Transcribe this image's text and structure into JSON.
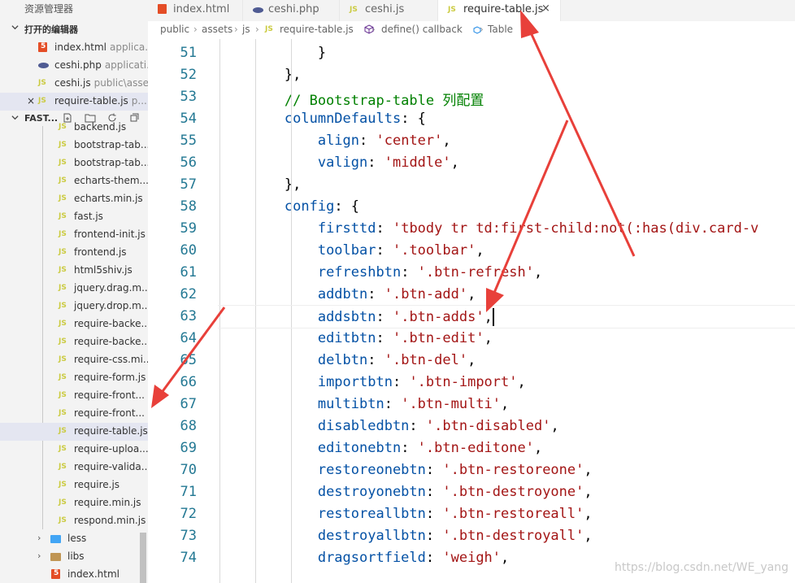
{
  "sidebar": {
    "title": "资源管理器",
    "open_editors_label": "打开的编辑器",
    "open_editors": [
      {
        "icon": "html",
        "name": "index.html",
        "sub": "applica..."
      },
      {
        "icon": "php",
        "name": "ceshi.php",
        "sub": "applicati..."
      },
      {
        "icon": "js",
        "name": "ceshi.js",
        "sub": "public\\asse..."
      },
      {
        "icon": "js",
        "name": "require-table.js",
        "sub": "p..."
      }
    ],
    "project_label": "FAST...",
    "files": [
      "backend.js",
      "bootstrap-tab...",
      "bootstrap-tab...",
      "echarts-them...",
      "echarts.min.js",
      "fast.js",
      "frontend-init.js",
      "frontend.js",
      "html5shiv.js",
      "jquery.drag.m...",
      "jquery.drop.m...",
      "require-backe...",
      "require-backe...",
      "require-css.mi...",
      "require-form.js",
      "require-front...",
      "require-front...",
      "require-table.js",
      "require-uploa...",
      "require-valida...",
      "require.js",
      "require.min.js",
      "respond.min.js"
    ],
    "folders": [
      "less",
      "libs"
    ],
    "last_file": "index.html",
    "js_badge": "JS"
  },
  "tabs": [
    {
      "icon": "html",
      "label": "index.html"
    },
    {
      "icon": "php",
      "label": "ceshi.php"
    },
    {
      "icon": "js",
      "label": "ceshi.js"
    },
    {
      "icon": "js",
      "label": "require-table.js",
      "active": true
    }
  ],
  "breadcrumb": {
    "parts": [
      "public",
      "assets",
      "js",
      "require-table.js",
      "define() callback",
      "Table"
    ],
    "separator": "›"
  },
  "editor": {
    "first_line": 51,
    "active_line": 63,
    "lines": [
      [
        {
          "t": "            }",
          "c": "p"
        }
      ],
      [
        {
          "t": "        },",
          "c": "p"
        }
      ],
      [
        {
          "t": "        // Bootstrap-table 列配置",
          "c": "c"
        }
      ],
      [
        {
          "t": "        ",
          "c": "p"
        },
        {
          "t": "columnDefaults",
          "c": "k"
        },
        {
          "t": ": {",
          "c": "p"
        }
      ],
      [
        {
          "t": "            ",
          "c": "p"
        },
        {
          "t": "align",
          "c": "k"
        },
        {
          "t": ": ",
          "c": "p"
        },
        {
          "t": "'center'",
          "c": "s"
        },
        {
          "t": ",",
          "c": "p"
        }
      ],
      [
        {
          "t": "            ",
          "c": "p"
        },
        {
          "t": "valign",
          "c": "k"
        },
        {
          "t": ": ",
          "c": "p"
        },
        {
          "t": "'middle'",
          "c": "s"
        },
        {
          "t": ",",
          "c": "p"
        }
      ],
      [
        {
          "t": "        },",
          "c": "p"
        }
      ],
      [
        {
          "t": "        ",
          "c": "p"
        },
        {
          "t": "config",
          "c": "k"
        },
        {
          "t": ": {",
          "c": "p"
        }
      ],
      [
        {
          "t": "            ",
          "c": "p"
        },
        {
          "t": "firsttd",
          "c": "k"
        },
        {
          "t": ": ",
          "c": "p"
        },
        {
          "t": "'tbody tr td:first-child:not(:has(div.card-v",
          "c": "s"
        }
      ],
      [
        {
          "t": "            ",
          "c": "p"
        },
        {
          "t": "toolbar",
          "c": "k"
        },
        {
          "t": ": ",
          "c": "p"
        },
        {
          "t": "'.toolbar'",
          "c": "s"
        },
        {
          "t": ",",
          "c": "p"
        }
      ],
      [
        {
          "t": "            ",
          "c": "p"
        },
        {
          "t": "refreshbtn",
          "c": "k"
        },
        {
          "t": ": ",
          "c": "p"
        },
        {
          "t": "'.btn-refresh'",
          "c": "s"
        },
        {
          "t": ",",
          "c": "p"
        }
      ],
      [
        {
          "t": "            ",
          "c": "p"
        },
        {
          "t": "addbtn",
          "c": "k"
        },
        {
          "t": ": ",
          "c": "p"
        },
        {
          "t": "'.btn-add'",
          "c": "s"
        },
        {
          "t": ",",
          "c": "p"
        }
      ],
      [
        {
          "t": "            ",
          "c": "p"
        },
        {
          "t": "addsbtn",
          "c": "k"
        },
        {
          "t": ": ",
          "c": "p"
        },
        {
          "t": "'.btn-adds'",
          "c": "s"
        },
        {
          "t": ",",
          "c": "p"
        }
      ],
      [
        {
          "t": "            ",
          "c": "p"
        },
        {
          "t": "editbtn",
          "c": "k"
        },
        {
          "t": ": ",
          "c": "p"
        },
        {
          "t": "'.btn-edit'",
          "c": "s"
        },
        {
          "t": ",",
          "c": "p"
        }
      ],
      [
        {
          "t": "            ",
          "c": "p"
        },
        {
          "t": "delbtn",
          "c": "k"
        },
        {
          "t": ": ",
          "c": "p"
        },
        {
          "t": "'.btn-del'",
          "c": "s"
        },
        {
          "t": ",",
          "c": "p"
        }
      ],
      [
        {
          "t": "            ",
          "c": "p"
        },
        {
          "t": "importbtn",
          "c": "k"
        },
        {
          "t": ": ",
          "c": "p"
        },
        {
          "t": "'.btn-import'",
          "c": "s"
        },
        {
          "t": ",",
          "c": "p"
        }
      ],
      [
        {
          "t": "            ",
          "c": "p"
        },
        {
          "t": "multibtn",
          "c": "k"
        },
        {
          "t": ": ",
          "c": "p"
        },
        {
          "t": "'.btn-multi'",
          "c": "s"
        },
        {
          "t": ",",
          "c": "p"
        }
      ],
      [
        {
          "t": "            ",
          "c": "p"
        },
        {
          "t": "disabledbtn",
          "c": "k"
        },
        {
          "t": ": ",
          "c": "p"
        },
        {
          "t": "'.btn-disabled'",
          "c": "s"
        },
        {
          "t": ",",
          "c": "p"
        }
      ],
      [
        {
          "t": "            ",
          "c": "p"
        },
        {
          "t": "editonebtn",
          "c": "k"
        },
        {
          "t": ": ",
          "c": "p"
        },
        {
          "t": "'.btn-editone'",
          "c": "s"
        },
        {
          "t": ",",
          "c": "p"
        }
      ],
      [
        {
          "t": "            ",
          "c": "p"
        },
        {
          "t": "restoreonebtn",
          "c": "k"
        },
        {
          "t": ": ",
          "c": "p"
        },
        {
          "t": "'.btn-restoreone'",
          "c": "s"
        },
        {
          "t": ",",
          "c": "p"
        }
      ],
      [
        {
          "t": "            ",
          "c": "p"
        },
        {
          "t": "destroyonebtn",
          "c": "k"
        },
        {
          "t": ": ",
          "c": "p"
        },
        {
          "t": "'.btn-destroyone'",
          "c": "s"
        },
        {
          "t": ",",
          "c": "p"
        }
      ],
      [
        {
          "t": "            ",
          "c": "p"
        },
        {
          "t": "restoreallbtn",
          "c": "k"
        },
        {
          "t": ": ",
          "c": "p"
        },
        {
          "t": "'.btn-restoreall'",
          "c": "s"
        },
        {
          "t": ",",
          "c": "p"
        }
      ],
      [
        {
          "t": "            ",
          "c": "p"
        },
        {
          "t": "destroyallbtn",
          "c": "k"
        },
        {
          "t": ": ",
          "c": "p"
        },
        {
          "t": "'.btn-destroyall'",
          "c": "s"
        },
        {
          "t": ",",
          "c": "p"
        }
      ],
      [
        {
          "t": "            ",
          "c": "p"
        },
        {
          "t": "dragsortfield",
          "c": "k"
        },
        {
          "t": ": ",
          "c": "p"
        },
        {
          "t": "'weigh'",
          "c": "s"
        },
        {
          "t": ",",
          "c": "p"
        }
      ]
    ]
  },
  "watermark": "https://blog.csdn.net/WE_yang",
  "colors": {
    "annotation_arrow": "#e8403a",
    "keyword": "#0451a5",
    "string": "#a31515",
    "comment": "#008000",
    "line_number": "#237893"
  }
}
